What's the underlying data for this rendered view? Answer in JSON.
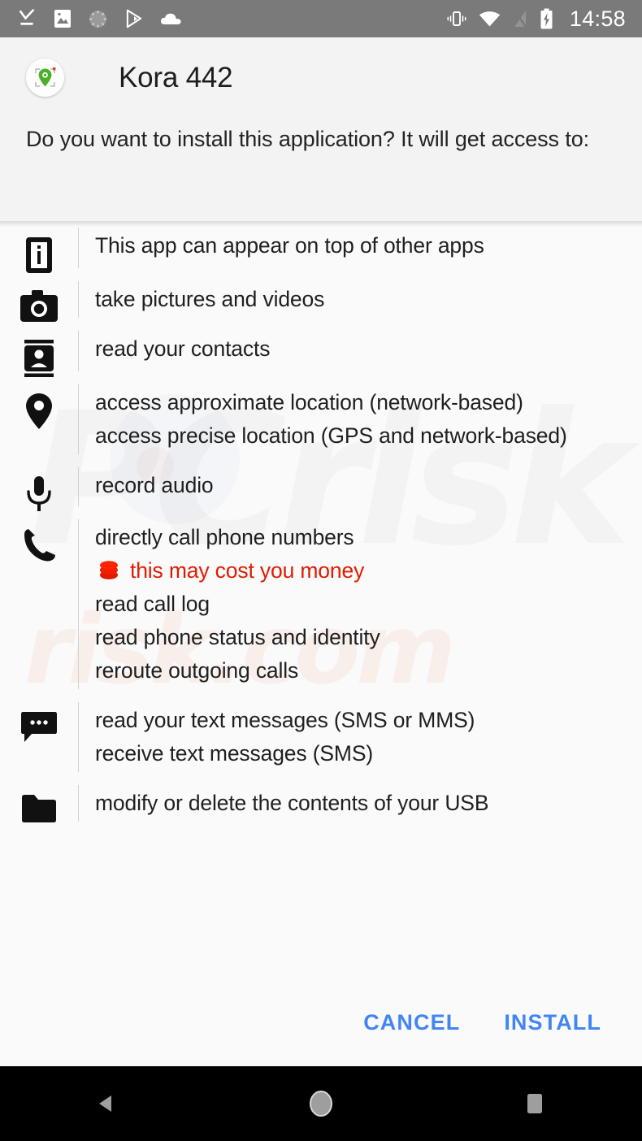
{
  "statusbar": {
    "time": "14:58",
    "left_icons": [
      {
        "name": "download-complete-icon"
      },
      {
        "name": "image-icon"
      },
      {
        "name": "sync-progress-icon"
      },
      {
        "name": "play-store-icon"
      },
      {
        "name": "cloud-icon"
      }
    ],
    "right_icons": [
      {
        "name": "vibrate-mode-icon"
      },
      {
        "name": "wifi-icon"
      },
      {
        "name": "no-sim-icon"
      },
      {
        "name": "battery-charging-icon"
      }
    ]
  },
  "header": {
    "app_name": "Kora 442",
    "app_icon": "location-pin-camera-icon",
    "prompt": "Do you want to install this application? It will get access to:"
  },
  "permissions": [
    {
      "icon": "appear-on-top-icon",
      "lines": [
        {
          "text": "This app can appear on top of other apps",
          "warning": false
        }
      ]
    },
    {
      "icon": "camera-icon",
      "lines": [
        {
          "text": "take pictures and videos",
          "warning": false
        }
      ]
    },
    {
      "icon": "contacts-icon",
      "lines": [
        {
          "text": "read your contacts",
          "warning": false
        }
      ]
    },
    {
      "icon": "location-pin-icon",
      "lines": [
        {
          "text": "access approximate location (network-based)",
          "warning": false
        },
        {
          "text": "access precise location (GPS and network-based)",
          "warning": false
        }
      ]
    },
    {
      "icon": "microphone-icon",
      "lines": [
        {
          "text": "record audio",
          "warning": false
        }
      ]
    },
    {
      "icon": "phone-icon",
      "lines": [
        {
          "text": "directly call phone numbers",
          "warning": false
        },
        {
          "text": "this may cost you money",
          "warning": true
        },
        {
          "text": "read call log",
          "warning": false
        },
        {
          "text": "read phone status and identity",
          "warning": false
        },
        {
          "text": "reroute outgoing calls",
          "warning": false
        }
      ]
    },
    {
      "icon": "sms-icon",
      "lines": [
        {
          "text": "read your text messages (SMS or MMS)",
          "warning": false
        },
        {
          "text": "receive text messages (SMS)",
          "warning": false
        }
      ]
    },
    {
      "icon": "folder-icon",
      "lines": [
        {
          "text": "modify or delete the contents of your USB",
          "warning": false
        }
      ]
    }
  ],
  "actions": {
    "cancel_label": "CANCEL",
    "install_label": "INSTALL",
    "accent_color": "#4285f4"
  },
  "warning_color": "#e01b00",
  "navbar": {
    "back": "back-button",
    "home": "home-button",
    "recents": "recents-button"
  },
  "watermark": {
    "top_text": "PCrisk",
    "bottom_text": "risk.com"
  }
}
